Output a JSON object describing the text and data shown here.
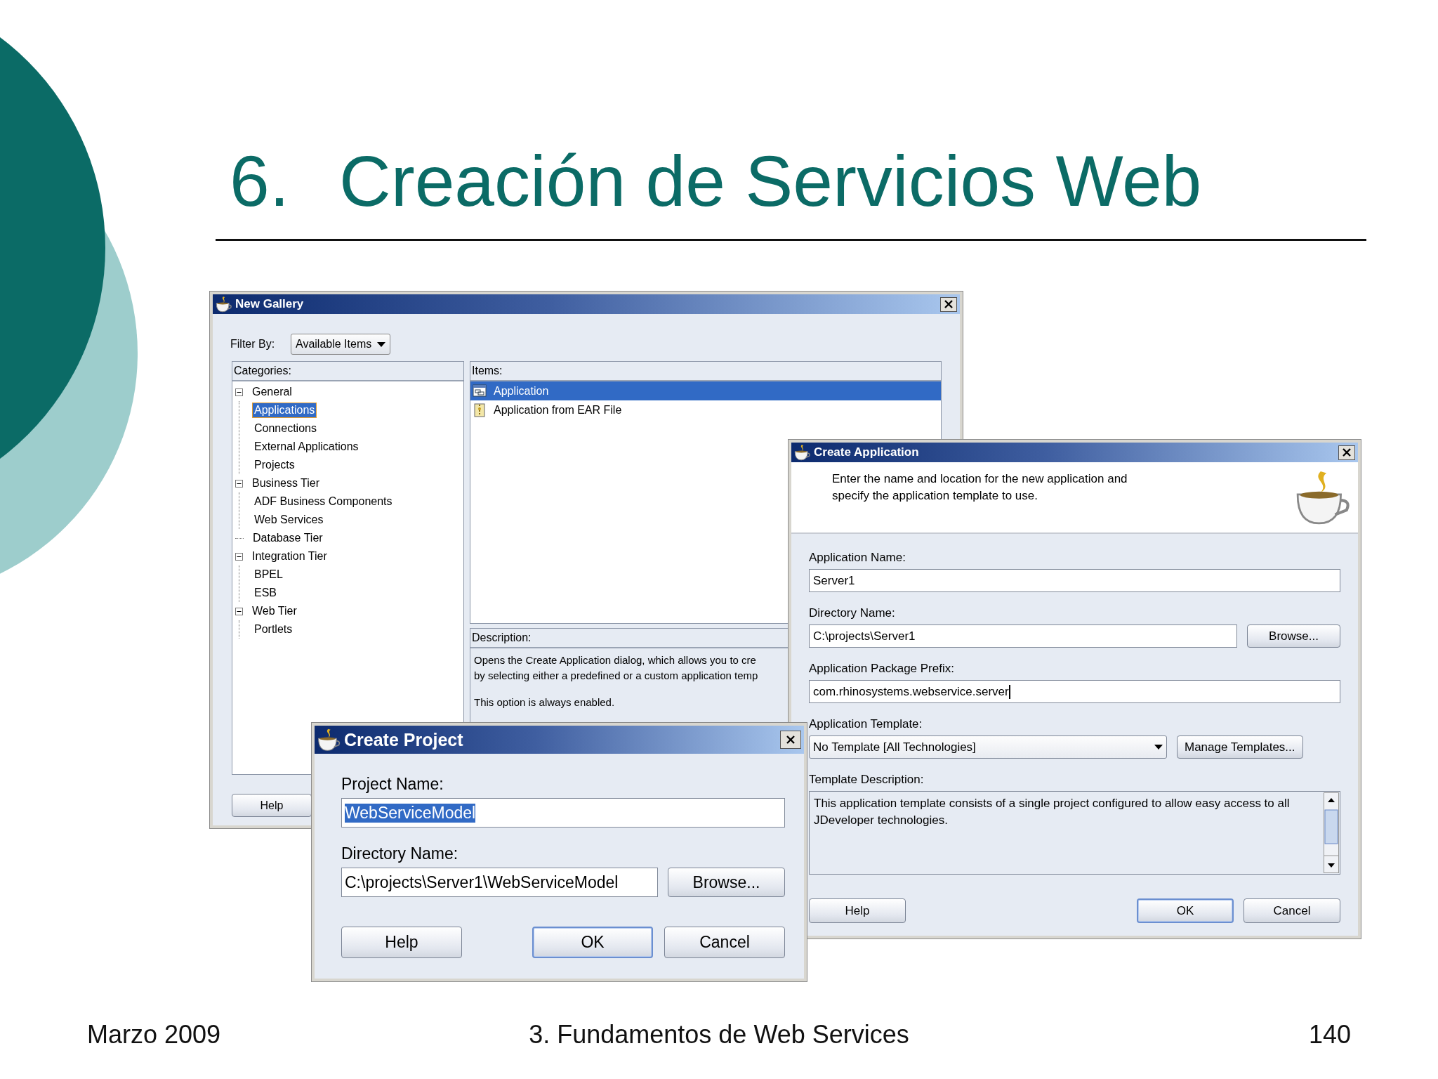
{
  "slide": {
    "number_label": "6.",
    "title": "Creación de Servicios Web",
    "footer_left": "Marzo 2009",
    "footer_center": "3. Fundamentos de Web Services",
    "page_number": "140"
  },
  "new_gallery": {
    "title": "New Gallery",
    "filter_label": "Filter By:",
    "filter_value": "Available Items",
    "categories_label": "Categories:",
    "categories": [
      {
        "label": "General",
        "selected": false,
        "expanded": true,
        "children": [
          {
            "label": "Applications",
            "selected": true
          },
          {
            "label": "Connections",
            "selected": false
          },
          {
            "label": "External Applications",
            "selected": false
          },
          {
            "label": "Projects",
            "selected": false
          }
        ]
      },
      {
        "label": "Business Tier",
        "selected": false,
        "expanded": true,
        "children": [
          {
            "label": "ADF Business Components",
            "selected": false
          },
          {
            "label": "Web Services",
            "selected": false
          }
        ]
      },
      {
        "label": "Database Tier",
        "selected": false
      },
      {
        "label": "Integration Tier",
        "selected": false,
        "expanded": true,
        "children": [
          {
            "label": "BPEL",
            "selected": false
          },
          {
            "label": "ESB",
            "selected": false
          }
        ]
      },
      {
        "label": "Web Tier",
        "selected": false,
        "expanded": true,
        "children": [
          {
            "label": "Portlets",
            "selected": false
          }
        ]
      }
    ],
    "items_label": "Items:",
    "items": [
      {
        "label": "Application",
        "selected": true,
        "kind": "window"
      },
      {
        "label": "Application from EAR File",
        "selected": false,
        "kind": "archive"
      }
    ],
    "description_label": "Description:",
    "description": [
      "Opens the Create Application dialog, which allows you to cre",
      "by selecting either a predefined or a custom application temp",
      "This option is always enabled."
    ],
    "buttons": [
      {
        "label": "Help",
        "default": false
      }
    ]
  },
  "create_application": {
    "title": "Create Application",
    "instructions": "Enter the name and location for the new application and\nspecify the application template to use.",
    "fields": [
      {
        "label": "Application Name:",
        "kind": "text",
        "value": "Server1",
        "focused": false
      },
      {
        "label": "Directory Name:",
        "kind": "text",
        "value": "C:\\projects\\Server1",
        "focused": false,
        "button": "Browse..."
      },
      {
        "label": "Application Package Prefix:",
        "kind": "text",
        "value": "com.rhinosystems.webservice.server",
        "focused": true
      },
      {
        "label": "Application Template:",
        "kind": "dropdown",
        "value": "No Template [All Technologies]",
        "button": "Manage Templates..."
      },
      {
        "label": "Template Description:",
        "kind": "textarea",
        "value": "This application template consists of a single project configured to allow easy access to all JDeveloper technologies."
      }
    ],
    "buttons": [
      {
        "label": "Help",
        "default": false
      },
      {
        "label": "OK",
        "default": true
      },
      {
        "label": "Cancel",
        "default": false
      }
    ]
  },
  "create_project": {
    "title": "Create Project",
    "fields": [
      {
        "label": "Project Name:",
        "kind": "text",
        "value": "WebServiceModel",
        "text_selected": true
      },
      {
        "label": "Directory Name:",
        "kind": "text",
        "value": "C:\\projects\\Server1\\WebServiceModel",
        "text_selected": false,
        "button": "Browse..."
      }
    ],
    "buttons": [
      {
        "label": "Help",
        "default": false
      },
      {
        "label": "OK",
        "default": true
      },
      {
        "label": "Cancel",
        "default": false
      }
    ]
  }
}
